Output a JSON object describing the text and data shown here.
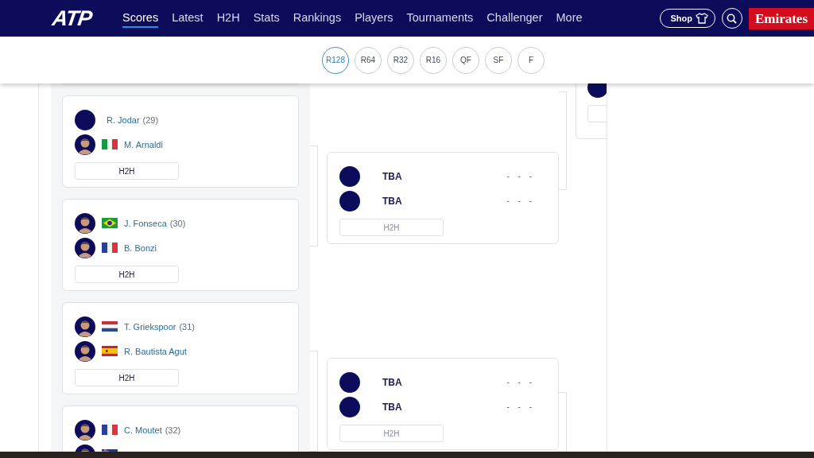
{
  "header": {
    "logo": "ATP",
    "nav": [
      {
        "label": "Scores",
        "selected": true
      },
      {
        "label": "Latest",
        "selected": false
      },
      {
        "label": "H2H",
        "selected": false
      },
      {
        "label": "Stats",
        "selected": false
      },
      {
        "label": "Rankings",
        "selected": false
      },
      {
        "label": "Players",
        "selected": false
      },
      {
        "label": "Tournaments",
        "selected": false
      },
      {
        "label": "Challenger",
        "selected": false
      },
      {
        "label": "More",
        "selected": false
      }
    ],
    "shop": "Shop",
    "sponsor": "Emirates"
  },
  "rounds": [
    {
      "label": "R128",
      "selected": true
    },
    {
      "label": "R64",
      "selected": false
    },
    {
      "label": "R32",
      "selected": false
    },
    {
      "label": "R16",
      "selected": false
    },
    {
      "label": "QF",
      "selected": false
    },
    {
      "label": "SF",
      "selected": false
    },
    {
      "label": "F",
      "selected": false
    }
  ],
  "bracket": {
    "columns": [
      {
        "matches": [
          {
            "players": [
              {
                "kind": "player",
                "photo": false,
                "name": "R. Jodar",
                "seed": "(29)"
              },
              {
                "kind": "player",
                "photo": true,
                "flag": {
                  "kind": "it"
                },
                "name": "M. Arnaldi"
              }
            ],
            "h2h": "H2H"
          },
          {
            "players": [
              {
                "kind": "player",
                "photo": true,
                "flag": {
                  "kind": "br"
                },
                "name": "J. Fonseca",
                "seed": "(30)"
              },
              {
                "kind": "player",
                "photo": true,
                "flag": {
                  "kind": "fr"
                },
                "name": "B. Bonzi"
              }
            ],
            "h2h": "H2H"
          },
          {
            "players": [
              {
                "kind": "player",
                "photo": true,
                "flag": {
                  "kind": "nl"
                },
                "name": "T. Griekspoor",
                "seed": "(31)"
              },
              {
                "kind": "player",
                "photo": true,
                "flag": {
                  "kind": "es"
                },
                "name": "R. Bautista Agut"
              }
            ],
            "h2h": "H2H"
          },
          {
            "players": [
              {
                "kind": "player",
                "photo": true,
                "flag": {
                  "kind": "fr"
                },
                "name": "C. Moutet",
                "seed": "(32)"
              },
              {
                "kind": "player",
                "photo": true,
                "flag": {
                  "kind": "au"
                }
              }
            ]
          }
        ]
      },
      {
        "matches": [
          {
            "players": [
              {
                "kind": "tba",
                "photo": false,
                "name": "TBA",
                "score": "- - -"
              },
              {
                "kind": "tba",
                "photo": false,
                "name": "TBA",
                "score": "- - -"
              }
            ],
            "h2h": "H2H"
          },
          {
            "players": [
              {
                "kind": "tba",
                "photo": false,
                "name": "TBA",
                "score": "- - -"
              },
              {
                "kind": "tba",
                "photo": false,
                "name": "TBA",
                "score": "- - -"
              }
            ],
            "h2h": "H2H"
          }
        ]
      },
      {
        "matches": [
          {
            "players": [
              {
                "kind": "tba",
                "photo": false
              }
            ]
          }
        ]
      }
    ]
  }
}
